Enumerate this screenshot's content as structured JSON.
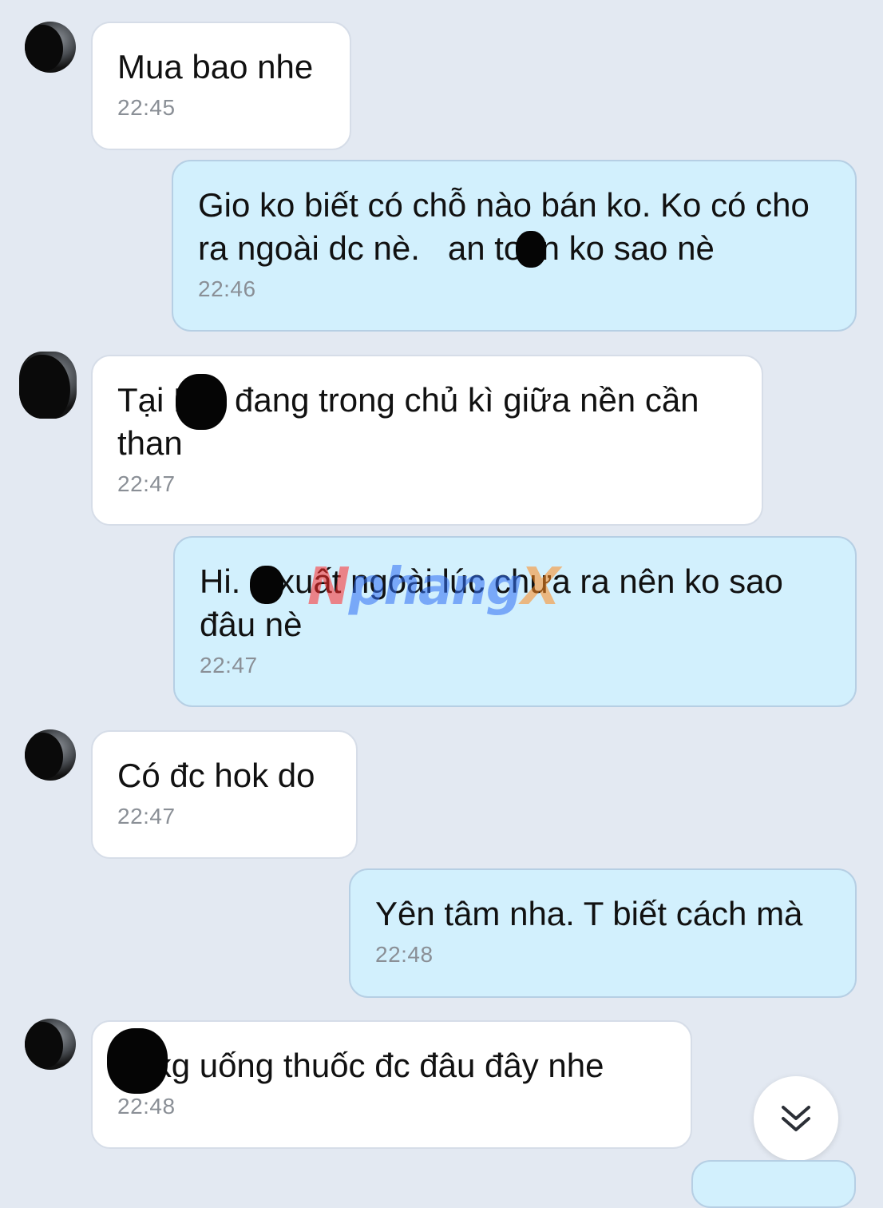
{
  "messages": [
    {
      "direction": "in",
      "text": "Mua bao nhe",
      "time": "22:45",
      "avatar": "contact-avatar"
    },
    {
      "direction": "out",
      "text": "Gio ko biết có chỗ nào bán ko. Ko có cho ra ngoài dc nè.   an toàn ko sao nè",
      "time": "22:46"
    },
    {
      "direction": "in",
      "text": "Tại N    đang trong chủ kì giữa nền cần than",
      "time": "22:47",
      "avatar": "contact-avatar"
    },
    {
      "direction": "out",
      "text": "Hi.    xuất ngoài lúc chưa ra nên ko sao đâu nè",
      "time": "22:47"
    },
    {
      "direction": "in",
      "text": "Có đc hok do",
      "time": "22:47",
      "avatar": "contact-avatar"
    },
    {
      "direction": "out",
      "text": "Yên tâm nha. T biết cách mà",
      "time": "22:48"
    },
    {
      "direction": "in",
      "text": "    kg uống thuốc đc đâu đây nhe",
      "time": "22:48",
      "avatar": "contact-avatar"
    }
  ],
  "watermark": {
    "part1": "N",
    "part2": "phang",
    "part3": "X"
  },
  "scroll_button": {
    "icon": "double-chevron-down-icon"
  },
  "colors": {
    "background": "#e3e9f2",
    "incoming": "#ffffff",
    "outgoing": "#d2f0fd",
    "time": "#8a8f96"
  }
}
